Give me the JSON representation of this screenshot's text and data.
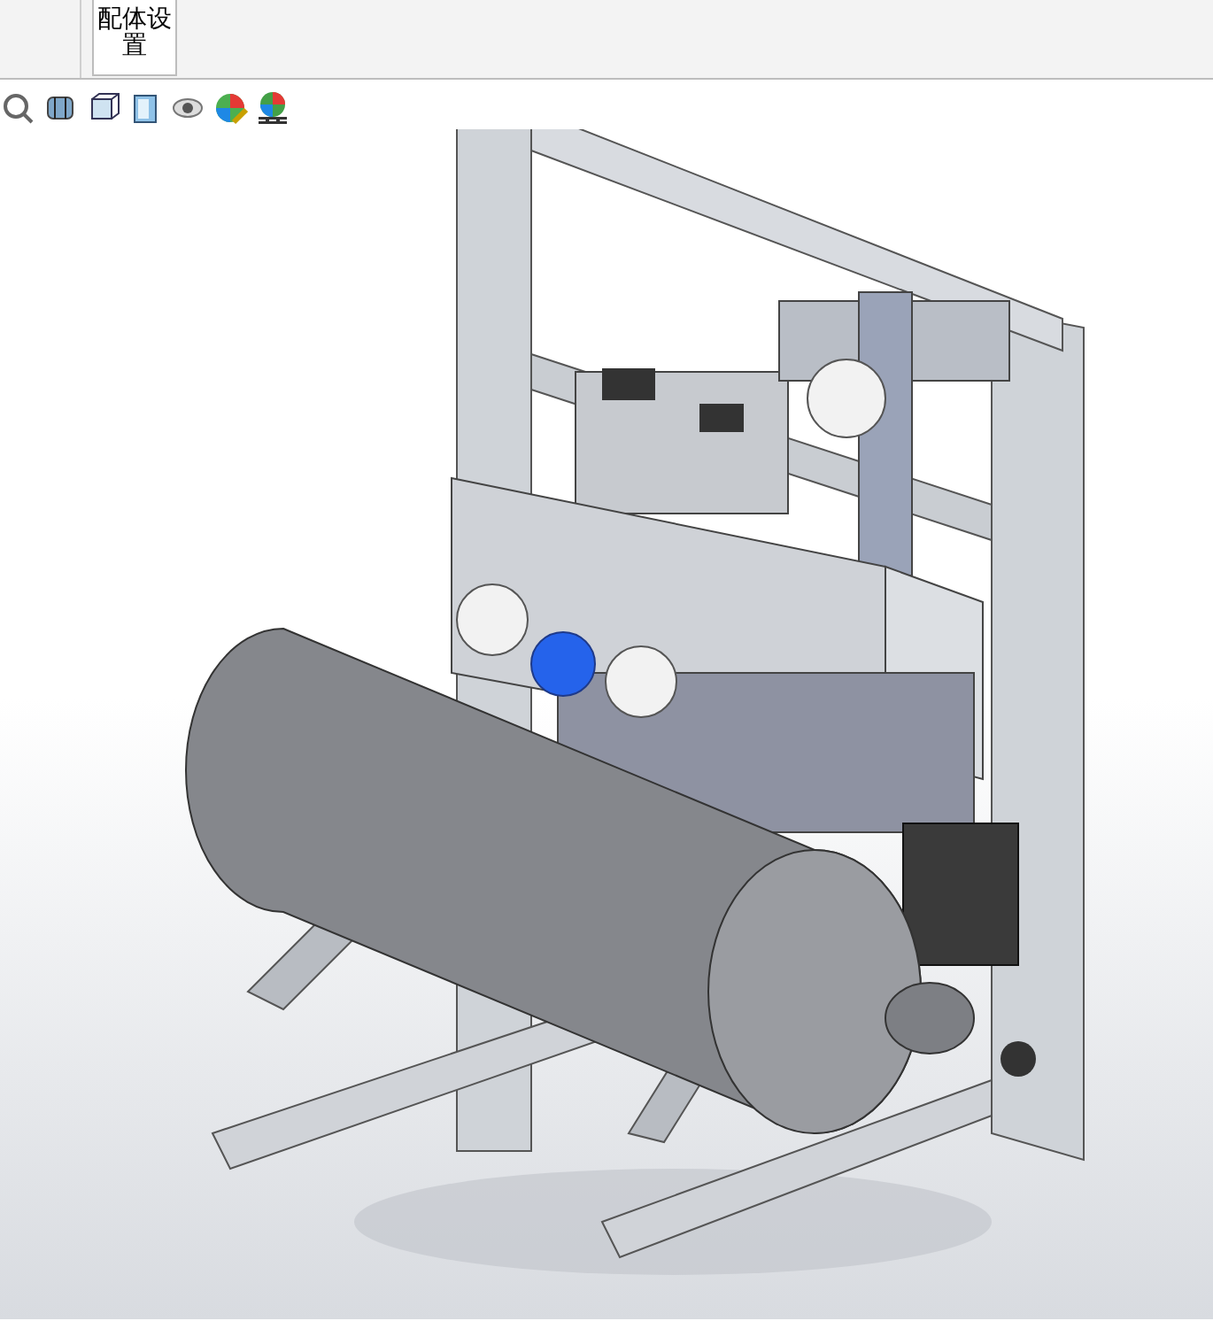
{
  "ribbon": {
    "buttons": [
      {
        "label": "配体设置",
        "selected": true
      }
    ]
  }
}
